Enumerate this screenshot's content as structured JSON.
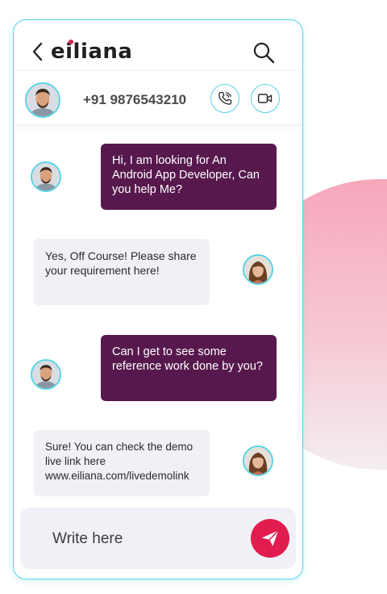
{
  "header": {
    "logo_text": "eiliana",
    "icons": {
      "back": "chevron-left-icon",
      "search": "search-icon"
    }
  },
  "contact": {
    "phone": "+91 9876543210",
    "icons": {
      "call": "phone-call-icon",
      "video": "video-camera-icon"
    }
  },
  "messages": [
    {
      "direction": "outgoing",
      "text": "Hi, I am looking for An Android App Developer, Can you help Me?"
    },
    {
      "direction": "incoming",
      "text": "Yes, Off Course! Please share your requirement here!"
    },
    {
      "direction": "outgoing",
      "text": "Can I get to see some reference work done by you?"
    },
    {
      "direction": "incoming",
      "text": "Sure! You can check the demo live link here www.eiliana.com/livedemolink"
    }
  ],
  "composer": {
    "placeholder": "Write here",
    "send_icon": "send-icon"
  },
  "colors": {
    "accent": "#56d3e3",
    "outgoing_bubble": "#57194d",
    "incoming_bubble": "#f0f1f6",
    "send_button": "#e11d4f",
    "logo_dot": "#e11d4f"
  }
}
